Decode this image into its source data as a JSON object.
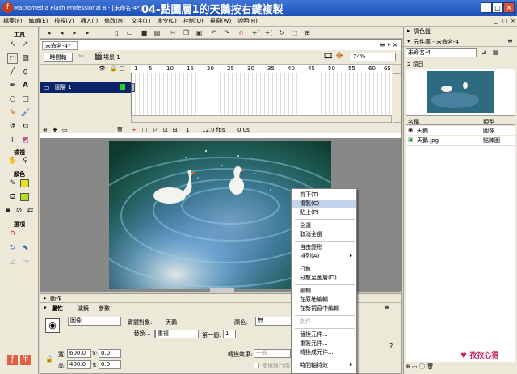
{
  "window": {
    "app_title": "Macromedia Flash Professional 8 - [未命名-4*]",
    "overlay_title": "04-點圖層1的天鵝按右鍵複製",
    "min": "_",
    "max": "□",
    "close": "×",
    "doc_min": "_",
    "doc_max": "□",
    "doc_close": "×"
  },
  "menu": [
    "檔案(F)",
    "編輯(E)",
    "檢視(V)",
    "插入(I)",
    "修改(M)",
    "文字(T)",
    "命令(C)",
    "控制(O)",
    "視窗(W)",
    "說明(H)"
  ],
  "tools": {
    "title": "工具",
    "view": "檢視",
    "colors": "顏色",
    "options": "選項"
  },
  "document": {
    "tab": "未命名-4*",
    "timeline_button": "時間軸",
    "scene": "場景 1",
    "zoom": "74%",
    "layer_name": "圖層 1",
    "ruler": [
      "1",
      "5",
      "10",
      "15",
      "20",
      "25",
      "30",
      "35",
      "40",
      "45",
      "50",
      "55",
      "60",
      "65"
    ],
    "frame": "1",
    "fps": "12.0 fps",
    "time": "0.0s"
  },
  "panels": {
    "actions": "動作",
    "tabs": [
      "屬性",
      "濾鏡",
      "參數"
    ],
    "symbol_type": "圖像",
    "instance_label": "實體對象:",
    "instance_name": "天鵝",
    "color_label": "顏色:",
    "color_value": "無",
    "swap": "替換...",
    "loop": "重複",
    "first_label": "第一個:",
    "first_value": "1",
    "w_label": "寬:",
    "w_value": "600.0",
    "h_label": "高:",
    "h_value": "400.0",
    "x_label": "X:",
    "x_value": "0.0",
    "y_label": "Y:",
    "y_value": "0.0",
    "blend_label": "轉換效果:",
    "blend_value": "一般",
    "cache": "使用執行階"
  },
  "library": {
    "color_panel": "調色盤",
    "title": "元件庫 - 未命名-4",
    "doc": "未命名-4",
    "count": "2 項目",
    "col_name": "名稱",
    "col_kind": "類型",
    "items": [
      {
        "name": "天鵝",
        "kind": "圖像"
      },
      {
        "name": "天鵝.jpg",
        "kind": "點陣圖"
      }
    ]
  },
  "context_menu": {
    "items": [
      "剪下(T)",
      "複製(C)",
      "貼上(P)",
      "全選",
      "取消全選",
      "自由變形",
      "排列(A)",
      "打散",
      "分散至圖層(D)",
      "編輯",
      "在原地編輯",
      "在新視窗中編輯",
      "創作",
      "替換元件...",
      "重製元件...",
      "轉換成元件...",
      "時間軸特效"
    ]
  },
  "brand": "♥ 孜孜心得"
}
